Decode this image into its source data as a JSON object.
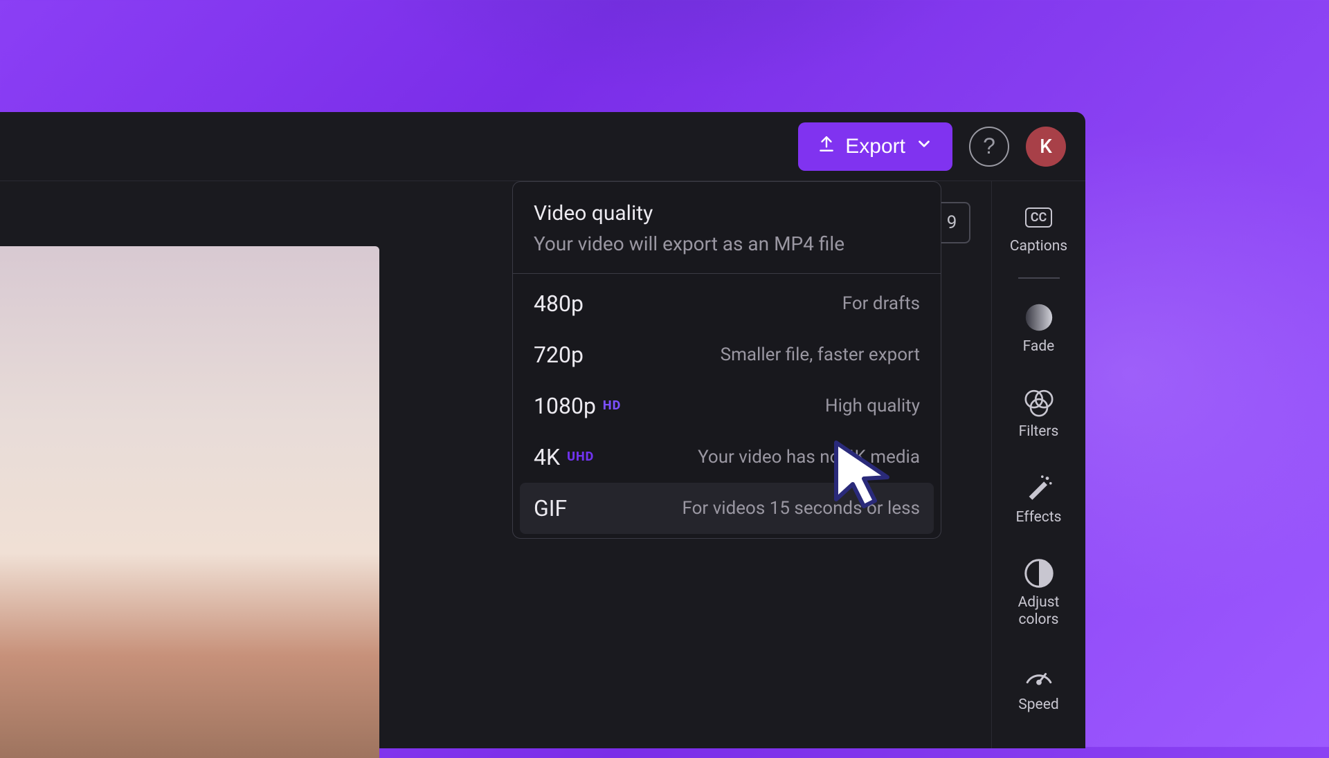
{
  "topbar": {
    "export_label": "Export",
    "help_label": "?",
    "avatar_initial": "K"
  },
  "peek_badge": "9",
  "dropdown": {
    "title": "Video quality",
    "subtitle": "Your video will export as an MP4 file",
    "options": [
      {
        "label": "480p",
        "badge": "",
        "badge_class": "",
        "desc": "For drafts"
      },
      {
        "label": "720p",
        "badge": "",
        "badge_class": "",
        "desc": "Smaller file, faster export"
      },
      {
        "label": "1080p",
        "badge": "HD",
        "badge_class": "badge-hd",
        "desc": "High quality"
      },
      {
        "label": "4K",
        "badge": "UHD",
        "badge_class": "badge-uhd",
        "desc": "Your video has no 4K media"
      },
      {
        "label": "GIF",
        "badge": "",
        "badge_class": "",
        "desc": "For videos 15 seconds or less"
      }
    ]
  },
  "sidebar": {
    "items": [
      {
        "label": "Captions"
      },
      {
        "label": "Fade"
      },
      {
        "label": "Filters"
      },
      {
        "label": "Effects"
      },
      {
        "label": "Adjust\ncolors"
      },
      {
        "label": "Speed"
      }
    ]
  }
}
